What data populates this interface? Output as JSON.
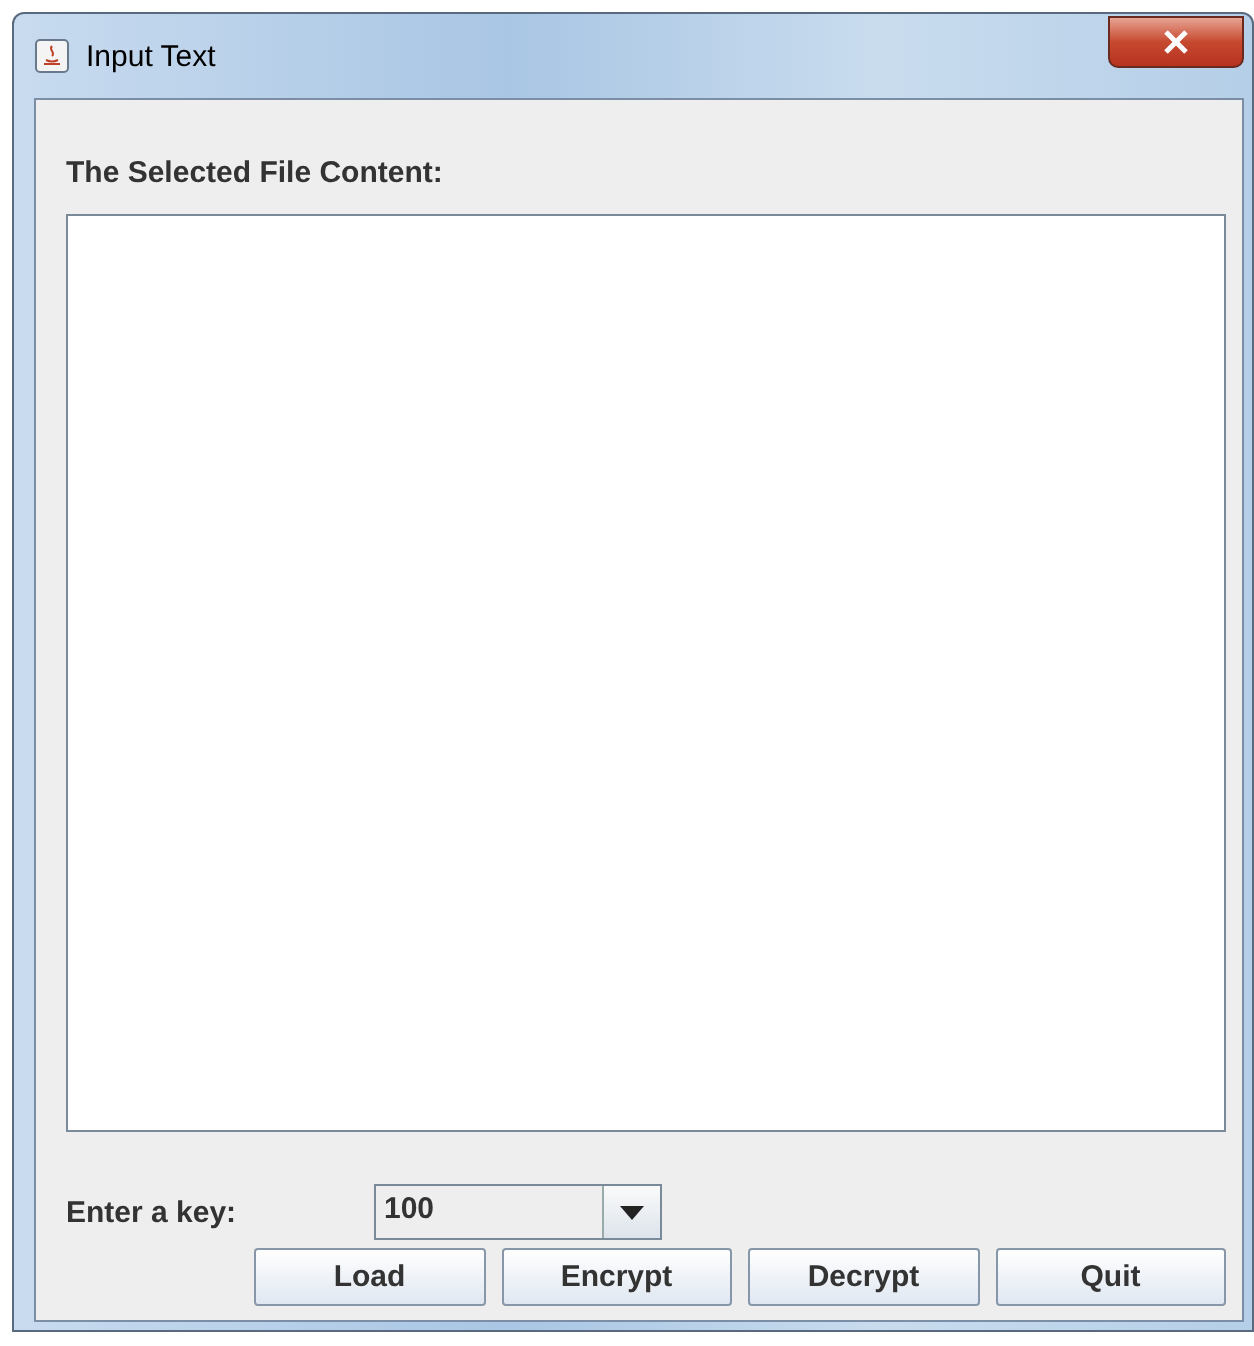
{
  "window": {
    "title": "Input Text"
  },
  "content_label": "The Selected File Content:",
  "key": {
    "label": "Enter a key:",
    "value": "100"
  },
  "buttons": [
    "Load",
    "Encrypt",
    "Decrypt",
    "Quit"
  ]
}
